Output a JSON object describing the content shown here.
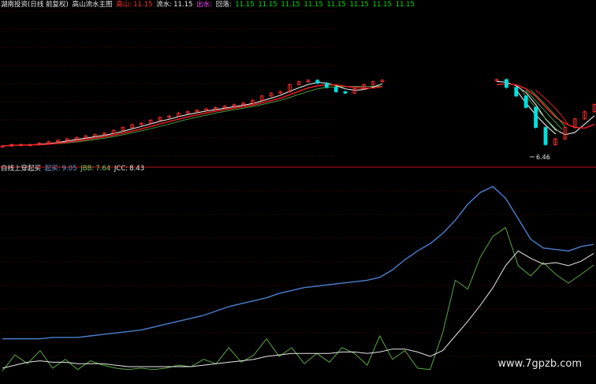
{
  "upper_header": {
    "label_main": "湖南投资(日线 前复权)",
    "indicator_name": "高山流水主图",
    "gaoshan_label": "高山:",
    "gaoshan_value": "11.15",
    "liushui_label": "流水:",
    "liushui_value": "11.15",
    "chushui_label": "出水:",
    "huilu_label": "回落:",
    "extra_values": [
      "11.15",
      "11.15",
      "11.15",
      "11.15",
      "11.15",
      "11.15",
      "11.15",
      "11.15"
    ]
  },
  "lower_header": {
    "indicator_name": "白线上穿起买",
    "s1_label": "起买:",
    "s1_value": "9.05",
    "s2_label": "JBB:",
    "s2_value": "7.64",
    "s3_label": "JCC:",
    "s3_value": "8.43"
  },
  "low_marker": "6.46",
  "watermark": "www.7gpzb.com",
  "colors": {
    "up": "#ff3030",
    "down": "#00e0e0",
    "ma_red": "#e02020",
    "ma_white": "#ffffff",
    "ma_green": "#4a9a40",
    "blue_line": "#4a80d0",
    "green_line": "#5aa840",
    "white_line": "#e8e8e8",
    "grid": "#8a1010"
  },
  "chart_data": [
    {
      "type": "candlestick",
      "title": "湖南投资(日线 前复权) 高山流水主图",
      "note": "price panel, values in price units",
      "series": [
        {
          "name": "close",
          "values": [
            6.5,
            6.6,
            6.6,
            6.6,
            6.7,
            6.8,
            6.9,
            7.0,
            7.1,
            7.2,
            7.3,
            7.4,
            7.6,
            7.8,
            8.0,
            8.1,
            8.3,
            8.5,
            8.6,
            8.8,
            8.9,
            9.0,
            9.1,
            9.2,
            9.3,
            9.4,
            9.5,
            9.7,
            10.0,
            10.2,
            10.3,
            10.8,
            11.0,
            11.1,
            10.9,
            10.6,
            10.3,
            10.2,
            10.5,
            10.8,
            11.0,
            11.1,
            11.15,
            10.6,
            10.0,
            9.2,
            7.8,
            6.6,
            7.0,
            7.8,
            8.4,
            8.9,
            9.4
          ]
        }
      ],
      "annotations": [
        "6.46"
      ]
    },
    {
      "type": "line",
      "title": "白线上穿起买",
      "series": [
        {
          "name": "起买",
          "values": [
            2.6,
            2.6,
            2.6,
            2.6,
            2.7,
            2.7,
            2.7,
            2.8,
            2.9,
            3.0,
            3.1,
            3.2,
            3.4,
            3.6,
            3.8,
            4.0,
            4.2,
            4.5,
            4.8,
            5.0,
            5.2,
            5.4,
            5.7,
            5.9,
            6.1,
            6.2,
            6.3,
            6.4,
            6.5,
            6.6,
            6.8,
            7.3,
            8.0,
            8.6,
            9.1,
            9.8,
            10.7,
            11.8,
            12.6,
            13.0,
            12.2,
            10.8,
            9.4,
            8.8,
            8.7,
            8.6,
            8.9,
            9.05
          ]
        },
        {
          "name": "JBB",
          "values": [
            0.4,
            1.5,
            0.9,
            1.8,
            0.6,
            1.2,
            0.5,
            1.1,
            0.8,
            0.6,
            0.5,
            0.6,
            0.5,
            0.6,
            0.8,
            0.7,
            1.2,
            0.9,
            2.0,
            1.0,
            1.5,
            2.6,
            1.4,
            2.0,
            0.9,
            1.6,
            1.0,
            2.0,
            1.6,
            0.8,
            2.8,
            1.2,
            1.8,
            0.6,
            0.5,
            3.0,
            6.6,
            6.0,
            8.2,
            9.6,
            10.2,
            7.6,
            6.9,
            7.8,
            7.0,
            6.4,
            7.0,
            7.64
          ]
        },
        {
          "name": "JCC",
          "values": [
            0.6,
            0.8,
            1.0,
            1.1,
            1.0,
            1.0,
            0.9,
            0.9,
            0.9,
            0.8,
            0.7,
            0.7,
            0.7,
            0.7,
            0.7,
            0.7,
            0.8,
            0.9,
            1.0,
            1.1,
            1.2,
            1.4,
            1.5,
            1.6,
            1.6,
            1.6,
            1.6,
            1.7,
            1.7,
            1.6,
            1.7,
            1.9,
            1.9,
            1.7,
            1.4,
            1.8,
            2.8,
            3.8,
            4.9,
            6.1,
            7.6,
            8.6,
            8.1,
            7.7,
            7.8,
            7.6,
            7.9,
            8.43
          ]
        }
      ],
      "ylim": [
        0,
        14
      ]
    }
  ]
}
